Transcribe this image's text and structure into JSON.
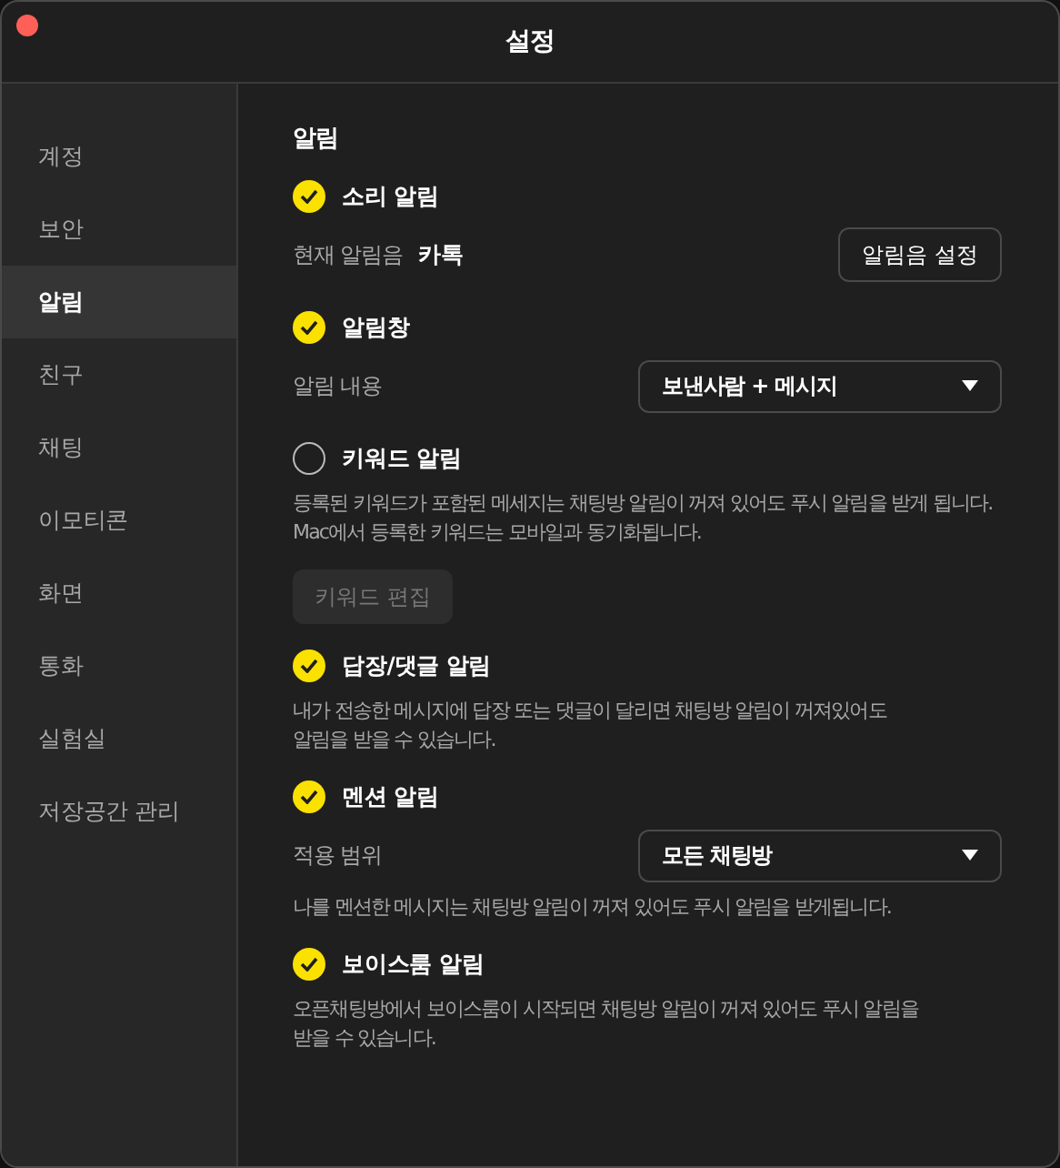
{
  "window": {
    "title": "설정"
  },
  "sidebar": {
    "items": [
      {
        "label": "계정",
        "selected": false
      },
      {
        "label": "보안",
        "selected": false
      },
      {
        "label": "알림",
        "selected": true
      },
      {
        "label": "친구",
        "selected": false
      },
      {
        "label": "채팅",
        "selected": false
      },
      {
        "label": "이모티콘",
        "selected": false
      },
      {
        "label": "화면",
        "selected": false
      },
      {
        "label": "통화",
        "selected": false
      },
      {
        "label": "실험실",
        "selected": false
      },
      {
        "label": "저장공간 관리",
        "selected": false
      }
    ]
  },
  "content": {
    "heading": "알림",
    "sections": [
      {
        "label": "소리 알림",
        "checked": true,
        "row": {
          "kind": "value",
          "label": "현재 알림음",
          "value": "카톡",
          "button": "알림음 설정"
        }
      },
      {
        "label": "알림창",
        "checked": true,
        "row": {
          "kind": "select",
          "label": "알림 내용",
          "value": "보낸사람 + 메시지"
        }
      },
      {
        "label": "키워드 알림",
        "checked": false,
        "description": "등록된 키워드가 포함된 메세지는 채팅방 알림이 꺼져 있어도 푸시 알림을 받게 됩니다. Mac에서 등록한 키워드는 모바일과 동기화됩니다.",
        "button": {
          "label": "키워드 편집",
          "disabled": true
        }
      },
      {
        "label": "답장/댓글 알림",
        "checked": true,
        "description": "내가 전송한 메시지에 답장 또는 댓글이 달리면 채팅방 알림이 꺼져있어도\n알림을 받을 수 있습니다."
      },
      {
        "label": "멘션 알림",
        "checked": true,
        "row": {
          "kind": "select",
          "label": "적용 범위",
          "value": "모든 채팅방"
        },
        "description": "나를 멘션한 메시지는 채팅방 알림이 꺼져 있어도 푸시 알림을 받게됩니다."
      },
      {
        "label": "보이스룸 알림",
        "checked": true,
        "description": "오픈채팅방에서 보이스룸이 시작되면 채팅방 알림이 꺼져 있어도 푸시 알림을\n받을 수 있습니다."
      }
    ]
  }
}
